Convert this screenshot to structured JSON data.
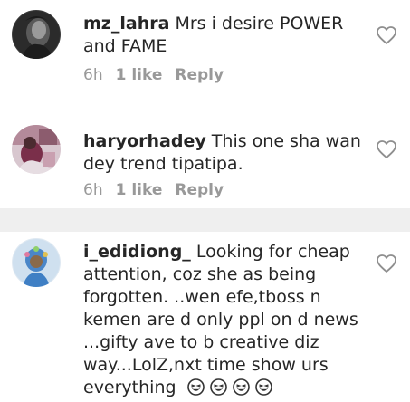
{
  "comments": [
    {
      "username": "mz_lahra",
      "text": "Mrs i desire POWER and FAME",
      "time": "6h",
      "likes": "1 like",
      "reply": "Reply",
      "avatar": "profile-photo-dark"
    },
    {
      "username": "haryorhadey",
      "text": "This one sha wan dey trend tipatipa.",
      "time": "6h",
      "likes": "1 like",
      "reply": "Reply",
      "avatar": "profile-photo-pink"
    },
    {
      "username": "i_edidiong_",
      "text": "Looking for cheap attention, coz she as being forgotten. ..wen efe,tboss n kemen are d only ppl on d news ...gifty ave to b creative diz way...LolZ,nxt time show urs everything",
      "emojis": [
        "laughing-emoji",
        "laughing-emoji",
        "laughing-emoji",
        "laughing-emoji"
      ],
      "avatar": "profile-photo-blue"
    }
  ],
  "icons": {
    "like": "heart-outline-icon"
  },
  "colors": {
    "text": "#262626",
    "meta": "#999999",
    "separator": "#efefef"
  }
}
